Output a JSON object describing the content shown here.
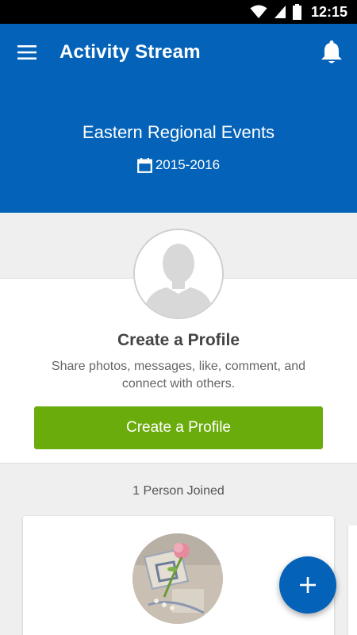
{
  "status_bar": {
    "time": "12:15"
  },
  "app_bar": {
    "title": "Activity Stream",
    "menu_icon": "hamburger-menu-icon",
    "bell_icon": "notification-bell-icon"
  },
  "event": {
    "name": "Eastern Regional Events",
    "dates": "2015-2016",
    "calendar_icon": "calendar-icon"
  },
  "profile_prompt": {
    "title": "Create a Profile",
    "description": "Share photos, messages, like, comment, and connect with others.",
    "button_label": "Create a Profile"
  },
  "members": {
    "joined_label": "1 Person Joined"
  },
  "fab": {
    "icon": "plus-icon"
  },
  "colors": {
    "primary": "#0463b8",
    "accent_green": "#6aac0c",
    "background": "#efefef"
  }
}
